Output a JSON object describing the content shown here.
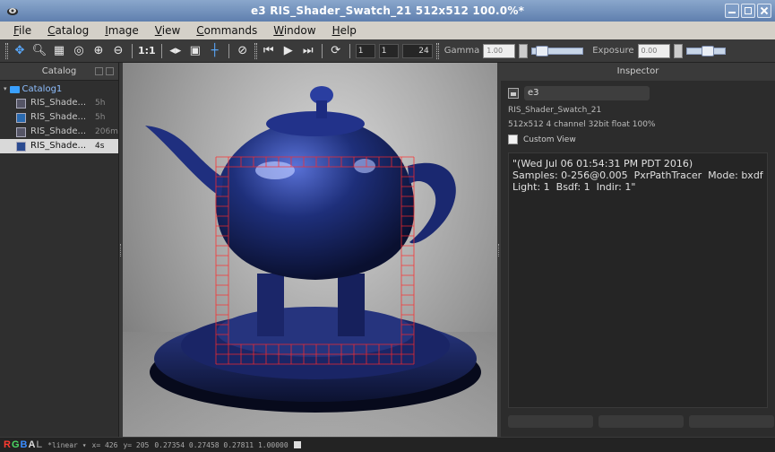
{
  "window": {
    "title": "e3 RIS_Shader_Swatch_21 512x512 100.0%*"
  },
  "menu": [
    "File",
    "Catalog",
    "Image",
    "View",
    "Commands",
    "Window",
    "Help"
  ],
  "toolbar": {
    "zoom_label": "1:1",
    "frame_fields": [
      "1",
      "1",
      "24"
    ],
    "gamma_label": "Gamma",
    "gamma_value": "1.00",
    "exposure_label": "Exposure",
    "exposure_value": "0.00"
  },
  "catalog": {
    "title": "Catalog",
    "root": "Catalog1",
    "items": [
      {
        "name": "RIS_Shade...",
        "time": "5h"
      },
      {
        "name": "RIS_Shade...",
        "time": "5h"
      },
      {
        "name": "RIS_Shade...",
        "time": "206m"
      },
      {
        "name": "RIS_Shade...",
        "time": "4s"
      }
    ]
  },
  "inspector": {
    "title": "Inspector",
    "name": "e3",
    "image_name": "RIS_Shader_Swatch_21",
    "image_info": "512x512 4 channel 32bit float 100%",
    "custom_view_label": "Custom View",
    "render_info": "\"(Wed Jul 06 01:54:31 PM PDT 2016)\nSamples: 0-256@0.005  PxrPathTracer  Mode: bxdf\nLight: 1  Bsdf: 1  Indir: 1\""
  },
  "status": {
    "channels": [
      "R",
      "G",
      "B",
      "A",
      "L"
    ],
    "colorspace": "*linear",
    "x": "x= 426",
    "y": "y= 205",
    "pixel_values": "0.27354 0.27458 0.27811 1.00000"
  },
  "colors": {
    "accent": "#3aa0ff",
    "bucket_grid": "#ff2020",
    "teapot": "#1a2a6a"
  }
}
